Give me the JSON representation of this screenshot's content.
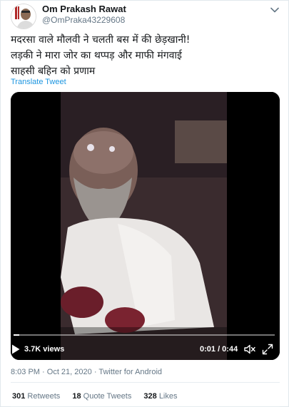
{
  "author": {
    "display_name": "Om Prakash Rawat",
    "handle": "@OmPraka43229608",
    "avatar_icon": "profile-photo"
  },
  "menu_icon": "chevron-down-icon",
  "tweet": {
    "lines": [
      "मदरसा वाले मौलवी ने चलती बस में की छेड़खानी!",
      "लड़की ने मारा जोर का थप्पड़ और माफी मंगवाई",
      "साहसी बहिन को प्रणाम"
    ],
    "translate_label": "Translate Tweet"
  },
  "video": {
    "views": "3.7K views",
    "time": "0:01 / 0:44",
    "progress": 0.023,
    "icons": [
      "play-icon",
      "volume-muted-icon",
      "fullscreen-icon"
    ]
  },
  "meta": {
    "time": "8:03 PM",
    "date": "Oct 21, 2020",
    "source": "Twitter for Android",
    "separator": "·"
  },
  "stats": [
    {
      "count": "301",
      "label": "Retweets"
    },
    {
      "count": "18",
      "label": "Quote Tweets"
    },
    {
      "count": "328",
      "label": "Likes"
    }
  ],
  "colors": {
    "link": "#1b95e0",
    "secondary_text": "#657786",
    "primary_text": "#14171a",
    "divider": "#e6ecf0"
  }
}
